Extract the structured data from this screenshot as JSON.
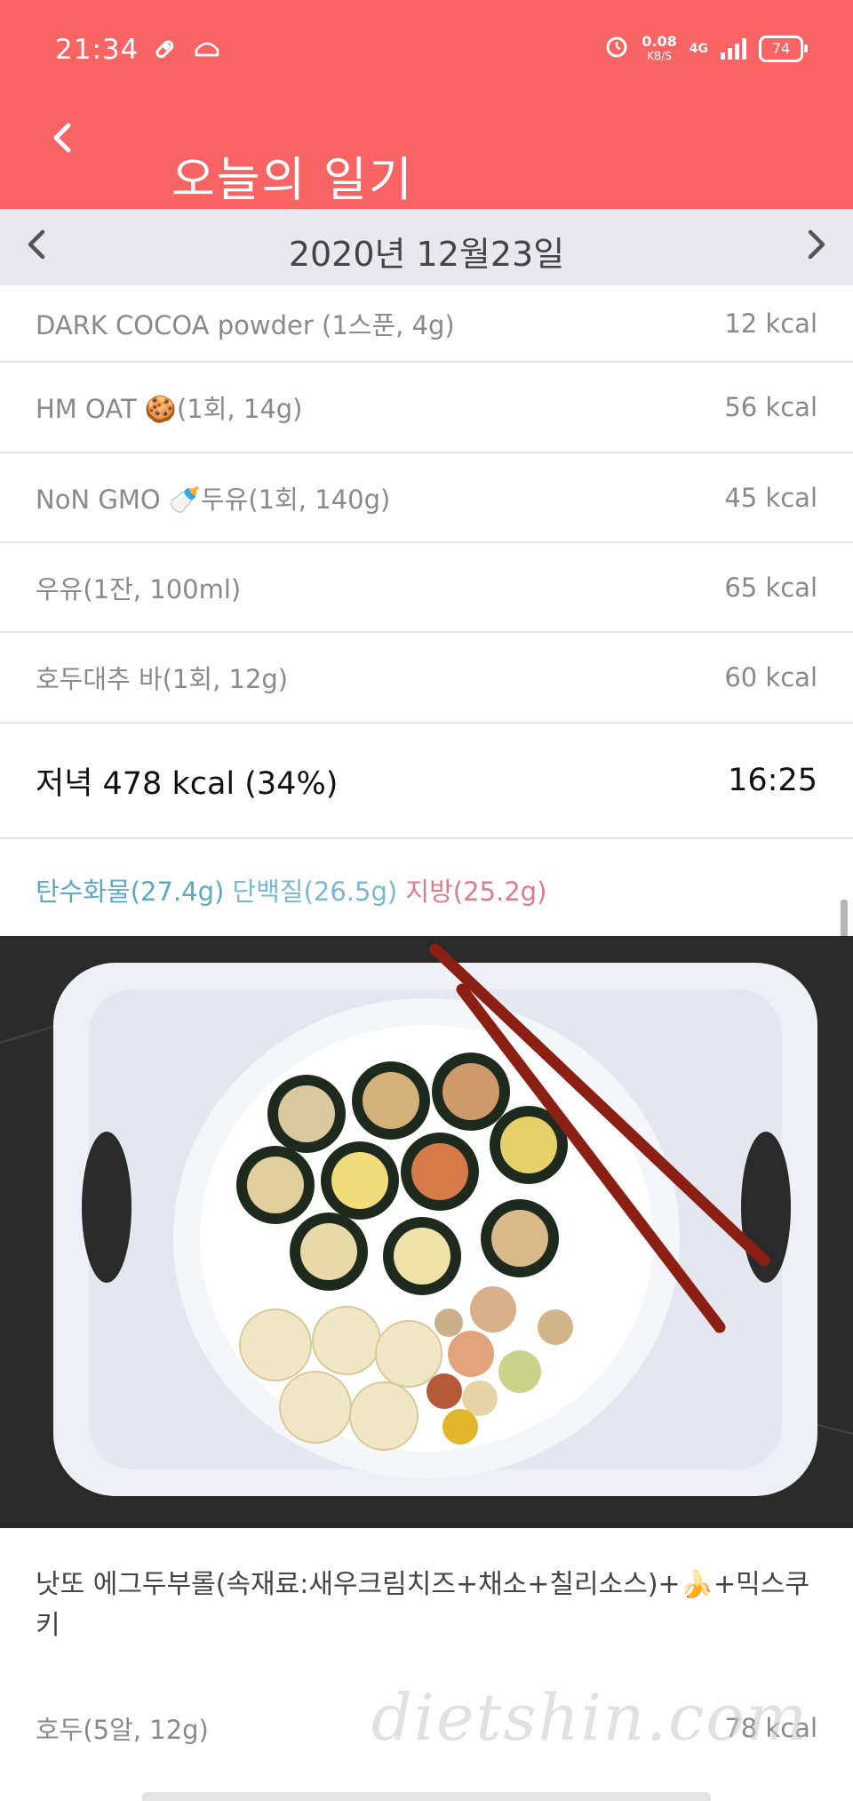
{
  "status_bar": {
    "time": "21:34",
    "net_speed": "0.08",
    "net_unit": "KB/S",
    "network": "4G",
    "battery": "74"
  },
  "header": {
    "title": "오늘의 일기",
    "back_icon": "chevron-left-icon",
    "background_color": "#f86363"
  },
  "date_bar": {
    "date": "2020년 12월23일",
    "prev_icon": "chevron-left-icon",
    "next_icon": "chevron-right-icon"
  },
  "items_before": [
    {
      "name": "DARK COCOA powder (1스푼, 4g)",
      "kcal": "12 kcal"
    },
    {
      "name": "HM OAT 🍪(1회, 14g)",
      "kcal": "56 kcal"
    },
    {
      "name": "NoN GMO 🍼두유(1회, 140g)",
      "kcal": "45 kcal"
    },
    {
      "name": "우유(1잔, 100ml)",
      "kcal": "65 kcal"
    },
    {
      "name": "호두대추 바(1회, 12g)",
      "kcal": "60 kcal"
    }
  ],
  "dinner": {
    "label": "저녁 478 kcal (34%)",
    "time": "16:25",
    "macros": {
      "carb": "탄수화물(27.4g)",
      "protein": "단백질(26.5g)",
      "fat": "지방(25.2g)"
    },
    "memo": "낫또 에그두부롤(속재료:새우크림치즈+채소+칠리소스)+🍌+믹스쿠키",
    "items": [
      {
        "name": "호두(5알, 12g)",
        "kcal": "78 kcal"
      }
    ]
  },
  "watermark": "dietshin.com"
}
